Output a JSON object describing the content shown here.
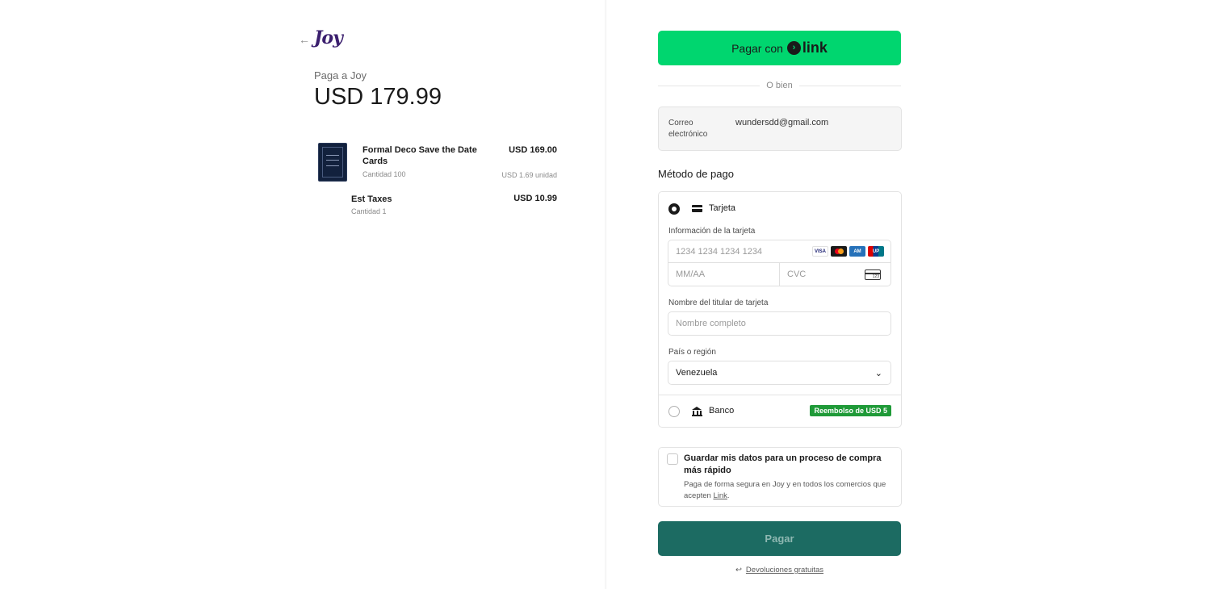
{
  "merchant": {
    "brand": "Joy",
    "pay_to": "Paga a Joy",
    "total": "USD 179.99"
  },
  "items": [
    {
      "name": "Formal Deco Save the Date Cards",
      "quantity": "Cantidad 100",
      "price": "USD 169.00",
      "unit_price": "USD 1.69 unidad"
    },
    {
      "name": "Est Taxes",
      "quantity": "Cantidad 1",
      "price": "USD 10.99"
    }
  ],
  "link_button": {
    "label": "Pagar con",
    "logo_text": "link",
    "color": "#00d66f"
  },
  "divider_text": "O bien",
  "email": {
    "label": "Correo electrónico",
    "value": "wundersdd@gmail.com"
  },
  "payment_method": {
    "title": "Método de pago",
    "card": {
      "label": "Tarjeta",
      "selected": true,
      "card_info_label": "Información de la tarjeta",
      "card_number_placeholder": "1234 1234 1234 1234",
      "expiry_placeholder": "MM/AA",
      "cvc_placeholder": "CVC",
      "brands": [
        "VISA",
        "mastercard",
        "amex",
        "unionpay"
      ],
      "holder_label": "Nombre del titular de tarjeta",
      "holder_placeholder": "Nombre completo",
      "country_label": "País o región",
      "country_value": "Venezuela"
    },
    "bank": {
      "label": "Banco",
      "badge": "Reembolso de USD 5",
      "selected": false
    }
  },
  "save_info": {
    "title": "Guardar mis datos para un proceso de compra más rápido",
    "desc_prefix": "Paga de forma segura en Joy y en todos los comercios que acepten ",
    "desc_link": "Link",
    "desc_suffix": "."
  },
  "pay_button": {
    "label": "Pagar",
    "color": "#1c6b62"
  },
  "returns": {
    "label": "Devoluciones gratuitas"
  }
}
